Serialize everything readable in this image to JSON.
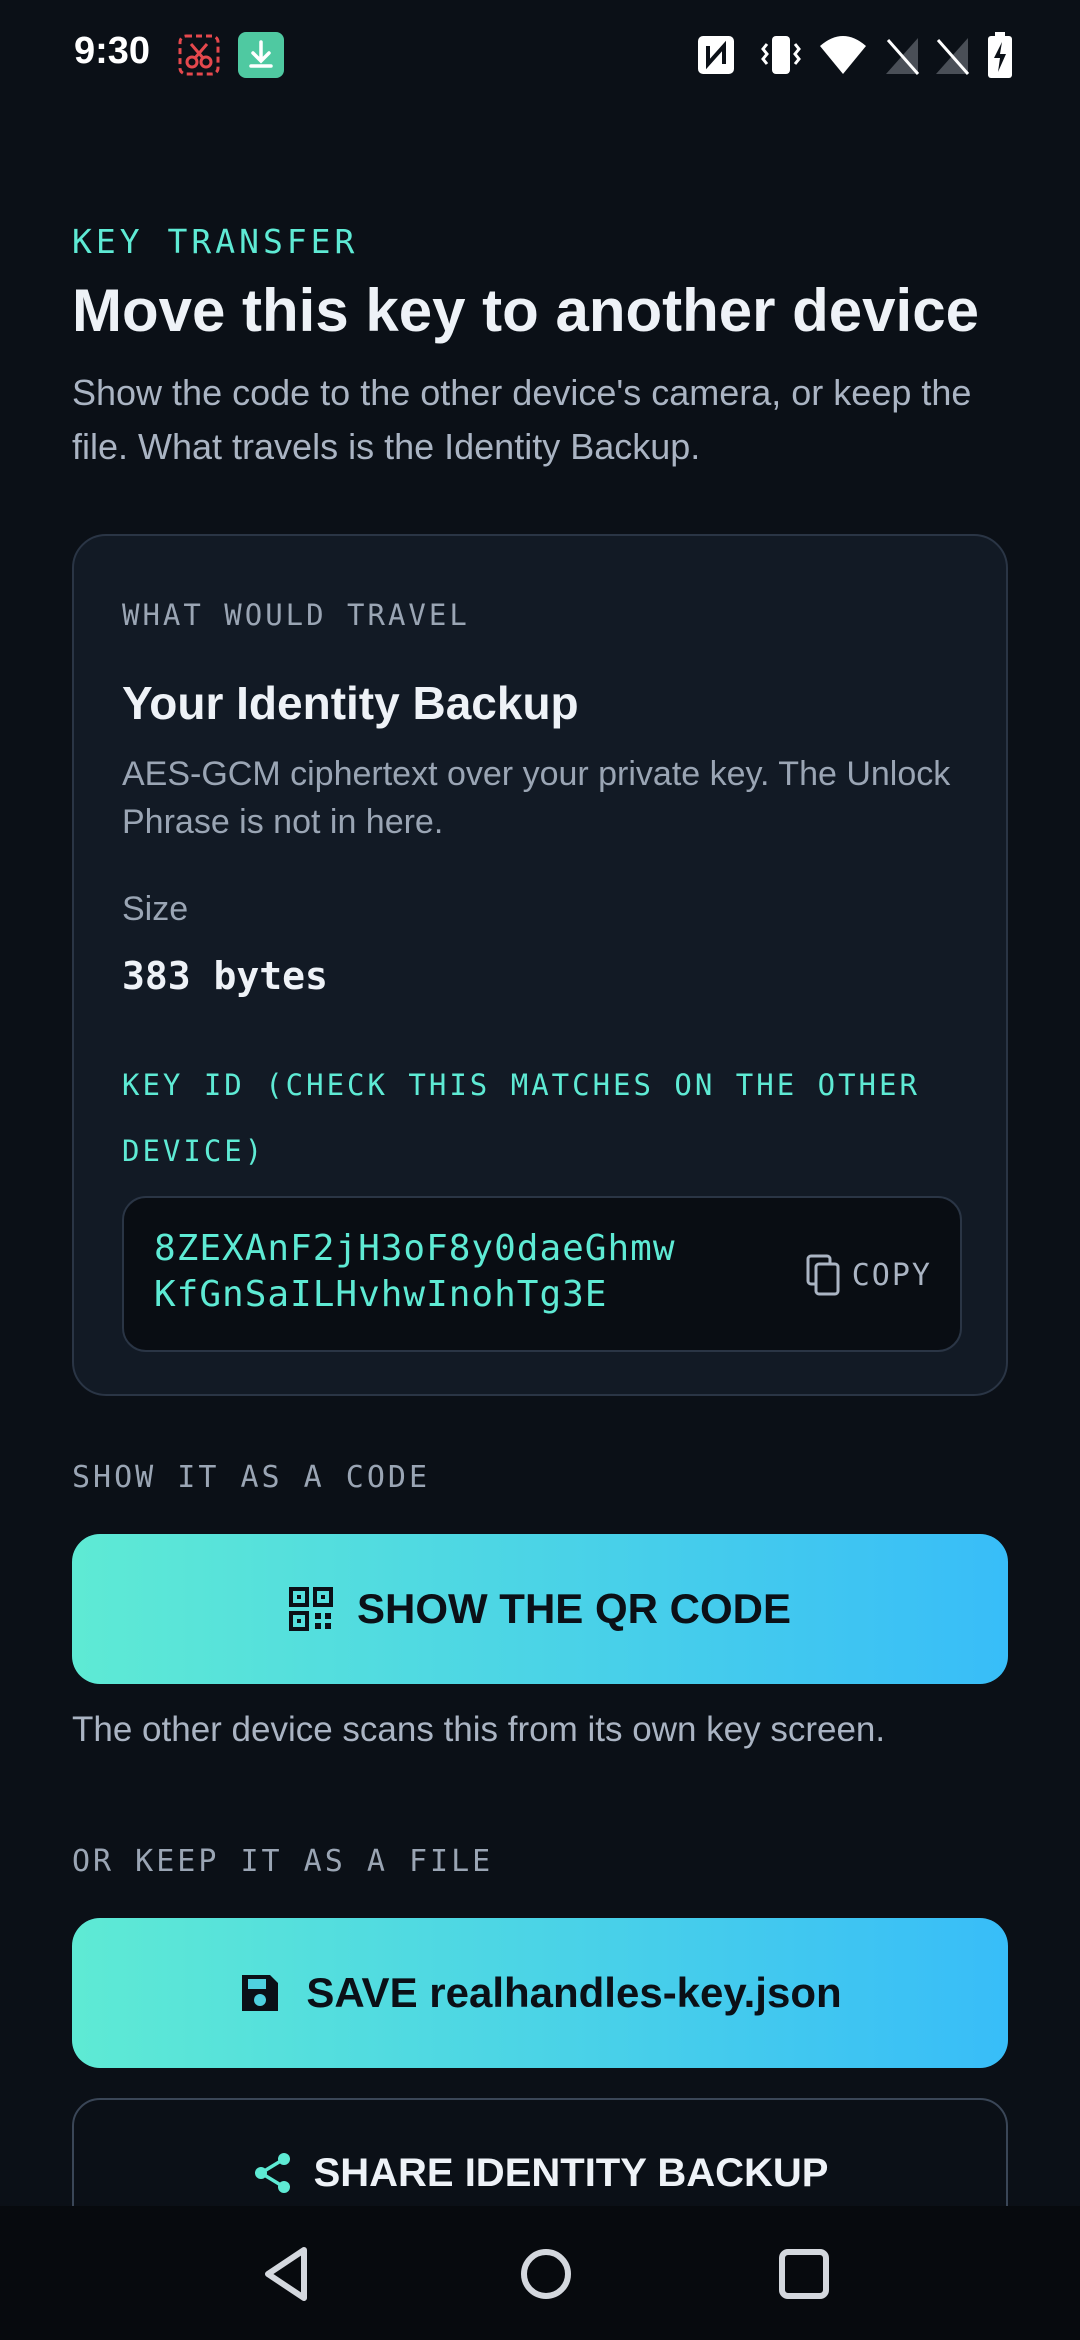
{
  "status_bar": {
    "time": "9:30",
    "left_icons": [
      "screenshot-cut-icon",
      "download-icon"
    ],
    "right_icons": [
      "nfc-icon",
      "vibrate-icon",
      "wifi-icon",
      "signal-off-icon",
      "signal-off-icon",
      "battery-charging-icon"
    ]
  },
  "header": {
    "eyebrow": "KEY TRANSFER",
    "title": "Move this key to another device",
    "subtitle": "Show the code to the other device's camera, or keep the file. What travels is the Identity Backup."
  },
  "card": {
    "eyebrow": "WHAT WOULD TRAVEL",
    "title": "Your Identity Backup",
    "description": "AES-GCM ciphertext over your private key. The Unlock Phrase is not in here.",
    "size_label": "Size",
    "size_value": "383 bytes",
    "key_id_label": "KEY ID (CHECK THIS MATCHES ON THE OTHER DEVICE)",
    "key_id_line1": "8ZEXAnF2jH3oF8y0daeGhmw",
    "key_id_line2": "KfGnSaILHvhwInohTg3E",
    "copy_label": "COPY"
  },
  "qr_section": {
    "label": "SHOW IT AS A CODE",
    "button_label": "SHOW THE QR CODE",
    "helper": "The other device scans this from its own key screen."
  },
  "file_section": {
    "label": "OR KEEP IT AS A FILE",
    "save_button_label": "SAVE realhandles-key.json",
    "share_button_label": "SHARE IDENTITY BACKUP"
  },
  "colors": {
    "background": "#0b1017",
    "accent_teal": "#5eead4",
    "accent_blue": "#38bdf8",
    "card": "#121a25"
  }
}
